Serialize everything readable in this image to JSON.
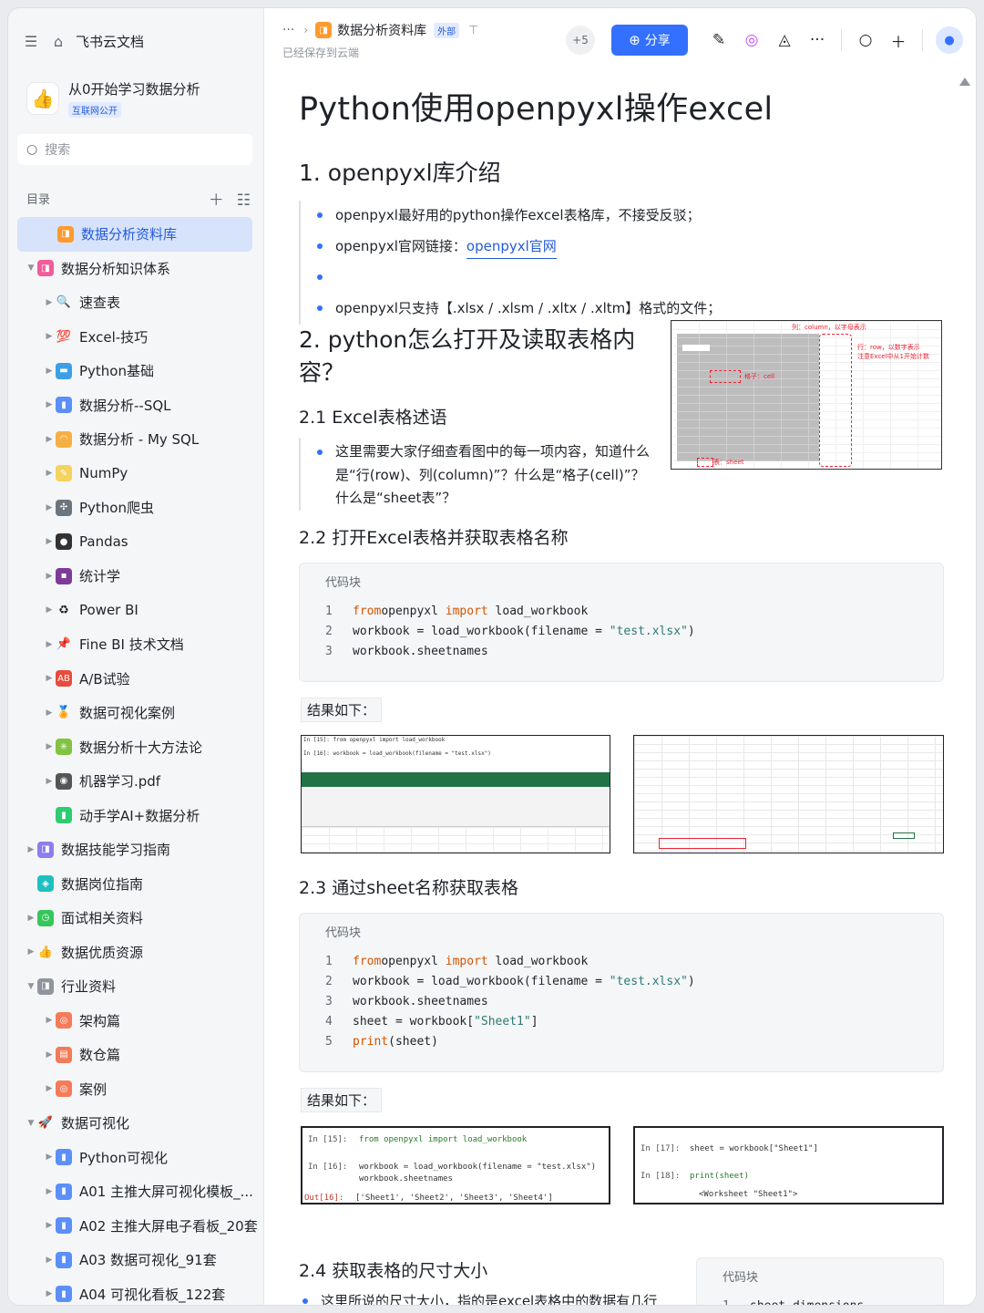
{
  "app": {
    "brand": "飞书云文档"
  },
  "space": {
    "name": "从0开始学习数据分析",
    "tag": "互联网公开"
  },
  "search": {
    "placeholder": "搜索"
  },
  "toc": {
    "title": "目录"
  },
  "tree": [
    {
      "label": "数据分析资料库",
      "level": 0,
      "arrow": "",
      "icon": "folder-icon",
      "icon_char": "◨",
      "icon_bg": "#ff9a2e",
      "active": true
    },
    {
      "label": "数据分析知识体系",
      "level": 0,
      "arrow": "▼",
      "icon": "knowledge-icon",
      "icon_char": "◨",
      "icon_bg": "#f25c9b"
    },
    {
      "label": "速查表",
      "level": 1,
      "arrow": "▶",
      "icon": "magnifier-icon",
      "icon_char": "🔍",
      "icon_bg": ""
    },
    {
      "label": "Excel-技巧",
      "level": 1,
      "arrow": "▶",
      "icon": "hundred-icon",
      "icon_char": "💯",
      "icon_bg": ""
    },
    {
      "label": "Python基础",
      "level": 1,
      "arrow": "▶",
      "icon": "monitor-icon",
      "icon_char": "▬",
      "icon_bg": "#3ca0e8"
    },
    {
      "label": "数据分析--SQL",
      "level": 1,
      "arrow": "▶",
      "icon": "bar-chart-icon",
      "icon_char": "▮",
      "icon_bg": "#5b8ff9"
    },
    {
      "label": "数据分析 - My SQL",
      "level": 1,
      "arrow": "▶",
      "icon": "rainbow-icon",
      "icon_char": "◠",
      "icon_bg": "#f5b041"
    },
    {
      "label": "NumPy",
      "level": 1,
      "arrow": "▶",
      "icon": "note-icon",
      "icon_char": "✎",
      "icon_bg": "#f4d35e"
    },
    {
      "label": "Python爬虫",
      "level": 1,
      "arrow": "▶",
      "icon": "spider-icon",
      "icon_char": "✣",
      "icon_bg": "#6c757d"
    },
    {
      "label": "Pandas",
      "level": 1,
      "arrow": "▶",
      "icon": "panda-icon",
      "icon_char": "●",
      "icon_bg": "#333"
    },
    {
      "label": "统计学",
      "level": 1,
      "arrow": "▶",
      "icon": "floppy-icon",
      "icon_char": "▪",
      "icon_bg": "#7d3c98"
    },
    {
      "label": "Power BI",
      "level": 1,
      "arrow": "▶",
      "icon": "recycle-icon",
      "icon_char": "♻",
      "icon_bg": ""
    },
    {
      "label": "Fine BI 技术文档",
      "level": 1,
      "arrow": "▶",
      "icon": "pin-icon",
      "icon_char": "📌",
      "icon_bg": ""
    },
    {
      "label": "A/B试验",
      "level": 1,
      "arrow": "▶",
      "icon": "ab-icon",
      "icon_char": "AB",
      "icon_bg": "#e74c3c"
    },
    {
      "label": "数据可视化案例",
      "level": 1,
      "arrow": "▶",
      "icon": "medal-icon",
      "icon_char": "🏅",
      "icon_bg": ""
    },
    {
      "label": "数据分析十大方法论",
      "level": 1,
      "arrow": "▶",
      "icon": "sparkle-icon",
      "icon_char": "✳",
      "icon_bg": "#82c341"
    },
    {
      "label": "机器学习.pdf",
      "level": 1,
      "arrow": "▶",
      "icon": "robot-icon",
      "icon_char": "◉",
      "icon_bg": "#555"
    },
    {
      "label": "动手学AI+数据分析",
      "level": 1,
      "arrow": "",
      "icon": "battery-icon",
      "icon_char": "▮",
      "icon_bg": "#2ecc71"
    },
    {
      "label": "数据技能学习指南",
      "level": 0,
      "arrow": "▶",
      "icon": "guide-icon",
      "icon_char": "◨",
      "icon_bg": "#8e7cf0"
    },
    {
      "label": "数据岗位指南",
      "level": 0,
      "arrow": "",
      "icon": "job-icon",
      "icon_char": "◈",
      "icon_bg": "#1fbfbf"
    },
    {
      "label": "面试相关资料",
      "level": 0,
      "arrow": "▶",
      "icon": "clock-icon",
      "icon_char": "◷",
      "icon_bg": "#34c759"
    },
    {
      "label": "数据优质资源",
      "level": 0,
      "arrow": "▶",
      "icon": "thumb-icon",
      "icon_char": "👍",
      "icon_bg": ""
    },
    {
      "label": "行业资料",
      "level": 0,
      "arrow": "▼",
      "icon": "industry-icon",
      "icon_char": "◨",
      "icon_bg": "#8f959e"
    },
    {
      "label": "架构篇",
      "level": 1,
      "arrow": "▶",
      "icon": "arch-icon",
      "icon_char": "◎",
      "icon_bg": "#f37b59"
    },
    {
      "label": "数仓篇",
      "level": 1,
      "arrow": "▶",
      "icon": "warehouse-icon",
      "icon_char": "▤",
      "icon_bg": "#f37b59"
    },
    {
      "label": "案例",
      "level": 1,
      "arrow": "▶",
      "icon": "case-icon",
      "icon_char": "◎",
      "icon_bg": "#f37b59"
    },
    {
      "label": "数据可视化",
      "level": 0,
      "arrow": "▼",
      "icon": "rocket-icon",
      "icon_char": "🚀",
      "icon_bg": ""
    },
    {
      "label": "Python可视化",
      "level": 1,
      "arrow": "▶",
      "icon": "bar-chart-icon",
      "icon_char": "▮",
      "icon_bg": "#5b8ff9"
    },
    {
      "label": "A01 主推大屏可视化模板_...",
      "level": 1,
      "arrow": "▶",
      "icon": "bar-chart-icon",
      "icon_char": "▮",
      "icon_bg": "#5b8ff9"
    },
    {
      "label": "A02 主推大屏电子看板_20套",
      "level": 1,
      "arrow": "▶",
      "icon": "bar-chart-icon",
      "icon_char": "▮",
      "icon_bg": "#5b8ff9"
    },
    {
      "label": "A03 数据可视化_91套",
      "level": 1,
      "arrow": "▶",
      "icon": "bar-chart-icon",
      "icon_char": "▮",
      "icon_bg": "#5b8ff9"
    },
    {
      "label": "A04 可视化看板_122套",
      "level": 1,
      "arrow": "▶",
      "icon": "bar-chart-icon",
      "icon_char": "▮",
      "icon_bg": "#5b8ff9"
    }
  ],
  "topbar": {
    "crumb_dots": "···",
    "doc_name": "数据分析资料库",
    "external": "外部",
    "saved": "已经保存到云端",
    "collab": "+5",
    "share": "分享"
  },
  "doc": {
    "title": "Python使用openpyxl操作excel",
    "s1": "1. openpyxl库介绍",
    "s1_b1": "openpyxl最好用的python操作excel表格库，不接受反驳；",
    "s1_b2_pre": "openpyxl官网链接：",
    "s1_b2_link": "openpyxl官网",
    "s1_b4": "openpyxl只支持【.xlsx / .xlsm / .xltx / .xltm】格式的文件；",
    "s2": "2. python怎么打开及读取表格内容？",
    "s21": "2.1 Excel表格述语",
    "s21_b1": "这里需要大家仔细查看图中的每一项内容，知道什么是“行(row)、列(column)”？什么是“格子(cell)”？什么是“sheet表”？",
    "s22": "2.2 打开Excel表格并获取表格名称",
    "code_label": "代码块",
    "result_label": "结果如下：",
    "s23": "2.3 通过sheet名称获取表格",
    "s24": "2.4 获取表格的尺寸大小",
    "s24_b1": "这里所说的尺寸大小，指的是excel表格中的数据有几行"
  },
  "code1": [
    {
      "n": "1",
      "parts": [
        [
          "kw",
          "from"
        ],
        [
          "",
          "openpyxl "
        ],
        [
          "kw",
          "import"
        ],
        [
          "",
          " load_workbook"
        ]
      ]
    },
    {
      "n": "2",
      "parts": [
        [
          "",
          "workbook = load_workbook(filename = "
        ],
        [
          "st",
          "\"test.xlsx\""
        ],
        [
          "",
          ")"
        ]
      ]
    },
    {
      "n": "3",
      "parts": [
        [
          "",
          "workbook.sheetnames"
        ]
      ]
    }
  ],
  "code2": [
    {
      "n": "1",
      "parts": [
        [
          "kw",
          "from"
        ],
        [
          "",
          "openpyxl "
        ],
        [
          "kw",
          "import"
        ],
        [
          "",
          " load_workbook"
        ]
      ]
    },
    {
      "n": "2",
      "parts": [
        [
          "",
          "workbook = load_workbook(filename = "
        ],
        [
          "st",
          "\"test.xlsx\""
        ],
        [
          "",
          ")"
        ]
      ]
    },
    {
      "n": "3",
      "parts": [
        [
          "",
          "workbook.sheetnames"
        ]
      ]
    },
    {
      "n": "4",
      "parts": [
        [
          "",
          "sheet = workbook["
        ],
        [
          "st",
          "\"Sheet1\""
        ],
        [
          "",
          "]"
        ]
      ]
    },
    {
      "n": "5",
      "parts": [
        [
          "kw",
          "print"
        ],
        [
          "",
          "(sheet)"
        ]
      ]
    }
  ],
  "code3": [
    {
      "n": "1",
      "parts": [
        [
          "",
          "sheet.dimensions"
        ]
      ]
    }
  ],
  "figure_excel": {
    "col_note": "列：column，以字母表示",
    "row_note": "行：row，以数字表示",
    "row_note2": "注意Excel中从1开始计数",
    "cell_note": "格子：cell",
    "sheet_note": "表：sheet"
  },
  "shot_a": {
    "in15": "In  [15]:",
    "code15": "from openpyxl import load_workbook",
    "in16": "In  [16]:",
    "code16": "workbook = load_workbook(filename = \"test.xlsx\")",
    "code16b": "workbook.sheetnames",
    "out16": "Out[16]:",
    "out16v": "['Sheet1', 'Sheet2', 'Sheet3', 'Sheet4']"
  },
  "shot_b": {
    "in17": "In  [17]:",
    "code17": "sheet = workbook[\"Sheet1\"]",
    "in18": "In  [18]:",
    "code18": "print(sheet)",
    "out18": "<Worksheet \"Sheet1\">"
  }
}
